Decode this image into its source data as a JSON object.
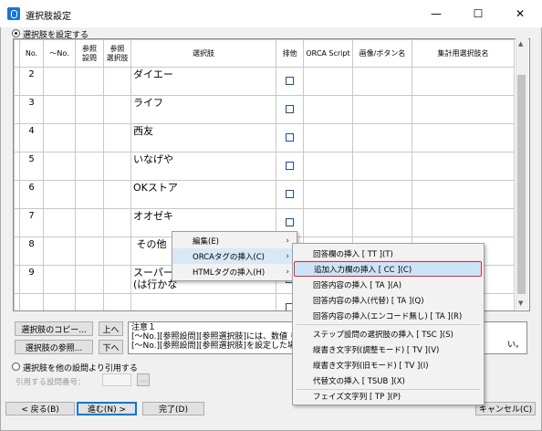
{
  "window": {
    "title": "選択肢設定",
    "min_glyph": "—",
    "max_glyph": "☐",
    "close_glyph": "✕"
  },
  "mode_set": {
    "label": "選択肢を設定する"
  },
  "table": {
    "headers": [
      "No.",
      "〜No.",
      "参照\n設問",
      "参照\n選択肢",
      "選択肢",
      "排他",
      "ORCA Script",
      "画像/ボタン名",
      "集計用選択肢名"
    ],
    "rows": [
      {
        "no": "2",
        "choice": "ダイエー",
        "exclusive": false
      },
      {
        "no": "3",
        "choice": "ライフ",
        "exclusive": false
      },
      {
        "no": "4",
        "choice": "西友",
        "exclusive": false
      },
      {
        "no": "5",
        "choice": "いなげや",
        "exclusive": false
      },
      {
        "no": "6",
        "choice": "OKストア",
        "exclusive": false
      },
      {
        "no": "7",
        "choice": "オオゼキ",
        "exclusive": false
      },
      {
        "no": "8",
        "choice": " その他",
        "exclusive": false
      },
      {
        "no": "9",
        "choice": "スーパー\n(は行かな",
        "exclusive": false
      },
      {
        "no": "",
        "choice": "",
        "exclusive": false
      }
    ]
  },
  "buttons": {
    "copy": "選択肢のコピー...",
    "ref": "選択肢の参照...",
    "up": "上へ",
    "down": "下へ",
    "back": "< 戻る(B)",
    "next": "進む(N) >",
    "finish": "完了(D)",
    "cancel": "キャンセル(C)",
    "browse": "..."
  },
  "note": {
    "text": "注意１\n[〜No.][参照設問][参照選択肢]には、数値 を\n[〜No.][参照設問][参照選択肢]を設定した場",
    "tail": "い。"
  },
  "mode_ref": {
    "label": "選択肢を他の設問より引用する",
    "field_label": "引用する設問番号：",
    "field_value": ""
  },
  "context_menu": {
    "items": [
      {
        "label": "編集(E)",
        "submenu": true
      },
      {
        "label": "ORCAタグの挿入(C)",
        "submenu": true
      },
      {
        "label": "HTMLタグの挿入(H)",
        "submenu": true
      }
    ],
    "submenu_glyph": "›"
  },
  "orca_submenu": {
    "items": [
      "回答欄の挿入 [ TT ](T)",
      "追加入力欄の挿入 [ CC ](C)",
      "回答内容の挿入 [ TA ](A)",
      "回答内容の挿入(代替) [ TA ](Q)",
      "回答内容の挿入(エンコード無し) [ TA ](R)",
      "ステップ設問の選択肢の挿入 [ TSC ](S)",
      "縦書き文字列(調整モード) [ TV ](V)",
      "縦書き文字列(旧モード) [ TV ](I)",
      "代替文の挿入 [ TSUB ](X)",
      "フェイズ文字列 [ TP ](P)"
    ],
    "highlighted_index": 1
  },
  "colors": {
    "highlight_border": "#d42a3a",
    "highlight_fill": "#cce4f7",
    "accent": "#0078d7"
  }
}
